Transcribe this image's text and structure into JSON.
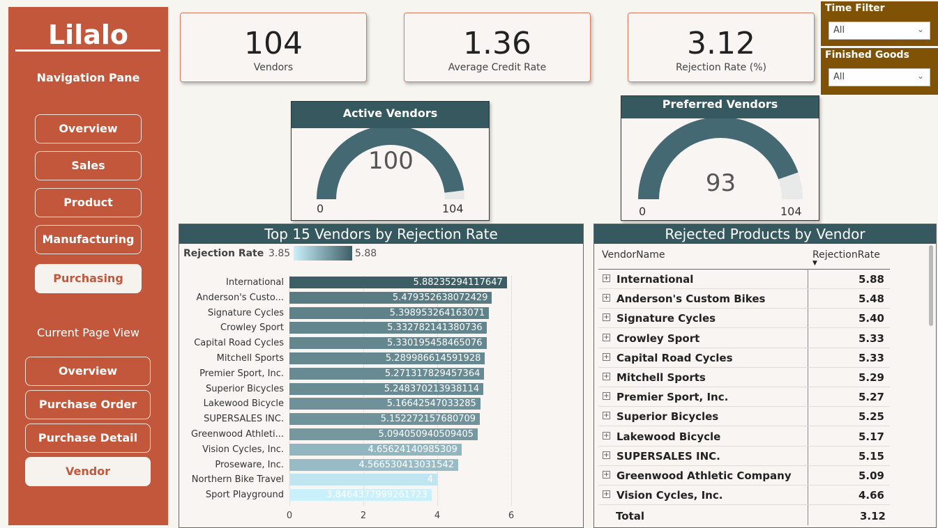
{
  "sidebar": {
    "logo": "Lilalo",
    "nav_title": "Navigation Pane",
    "nav_items": [
      {
        "label": "Overview"
      },
      {
        "label": "Sales"
      },
      {
        "label": "Product"
      },
      {
        "label": "Manufacturing"
      },
      {
        "label": "Purchasing"
      }
    ],
    "current_page_title": "Current Page View",
    "page_items": [
      {
        "label": "Overview"
      },
      {
        "label": "Purchase Order"
      },
      {
        "label": "Purchase Detail"
      },
      {
        "label": "Vendor"
      }
    ],
    "active_nav": "Purchasing",
    "active_page": "Vendor"
  },
  "kpis": [
    {
      "value": "104",
      "label": "Vendors"
    },
    {
      "value": "1.36",
      "label": "Average Credit Rate"
    },
    {
      "value": "3.12",
      "label": "Rejection Rate (%)"
    }
  ],
  "filters": [
    {
      "title": "Time Filter",
      "value": "All"
    },
    {
      "title": "Finished Goods",
      "value": "All"
    }
  ],
  "gauges": [
    {
      "title": "Active Vendors",
      "value": "100",
      "min": "0",
      "max": "104",
      "fraction": 0.9615
    },
    {
      "title": "Preferred Vendors",
      "value": "93",
      "min": "0",
      "max": "104",
      "fraction": 0.8942
    }
  ],
  "colors": {
    "sidebar": "#c3573c",
    "header": "#365960",
    "filter": "#7f5206",
    "gauge_fill": "#446972",
    "gauge_track": "#e9e9e9"
  },
  "chart_data": {
    "type": "bar",
    "orientation": "horizontal",
    "title": "Top 15 Vendors by Rejection Rate",
    "legend": {
      "title": "Rejection Rate",
      "min": "3.85",
      "max": "5.88"
    },
    "categories": [
      "International",
      "Anderson's Custo...",
      "Signature Cycles",
      "Crowley Sport",
      "Capital Road Cycles",
      "Mitchell Sports",
      "Premier Sport, Inc.",
      "Superior Bicycles",
      "Lakewood Bicycle",
      "SUPERSALES INC.",
      "Greenwood Athleti...",
      "Vision Cycles, Inc.",
      "Proseware, Inc.",
      "Northern Bike Travel",
      "Sport Playground"
    ],
    "values": [
      5.88235294117647,
      5.479352638072429,
      5.398953264163071,
      5.332782141380736,
      5.330195458465076,
      5.289986614591928,
      5.271317829457364,
      5.248370213938114,
      5.16642547033285,
      5.152272157680709,
      5.094050940509405,
      4.65624140985309,
      4.566530413031542,
      4,
      3.8464377999261723
    ],
    "value_labels": [
      "5.88235294117647",
      "5.479352638072429",
      "5.398953264163071",
      "5.332782141380736",
      "5.330195458465076",
      "5.289986614591928",
      "5.271317829457364",
      "5.248370213938114",
      "5.16642547033285",
      "5.152272157680709",
      "5.094050940509405",
      "4.65624140985309",
      "4.566530413031542",
      "4",
      "3.8464377999261723"
    ],
    "x_ticks": [
      "0",
      "2",
      "4",
      "6"
    ],
    "xlim": [
      0,
      6
    ],
    "color_min": "#c9f0fb",
    "color_max": "#3e5e66"
  },
  "table": {
    "title": "Rejected Products by Vendor",
    "columns": [
      "VendorName",
      "RejectionRate"
    ],
    "rows": [
      {
        "name": "International",
        "rate": "5.88"
      },
      {
        "name": "Anderson's Custom Bikes",
        "rate": "5.48"
      },
      {
        "name": "Signature Cycles",
        "rate": "5.40"
      },
      {
        "name": "Crowley Sport",
        "rate": "5.33"
      },
      {
        "name": "Capital Road Cycles",
        "rate": "5.33"
      },
      {
        "name": "Mitchell Sports",
        "rate": "5.29"
      },
      {
        "name": "Premier Sport, Inc.",
        "rate": "5.27"
      },
      {
        "name": "Superior Bicycles",
        "rate": "5.25"
      },
      {
        "name": "Lakewood Bicycle",
        "rate": "5.17"
      },
      {
        "name": "SUPERSALES INC.",
        "rate": "5.15"
      },
      {
        "name": "Greenwood Athletic Company",
        "rate": "5.09"
      },
      {
        "name": "Vision Cycles, Inc.",
        "rate": "4.66"
      }
    ],
    "total_label": "Total",
    "total_value": "3.12"
  }
}
